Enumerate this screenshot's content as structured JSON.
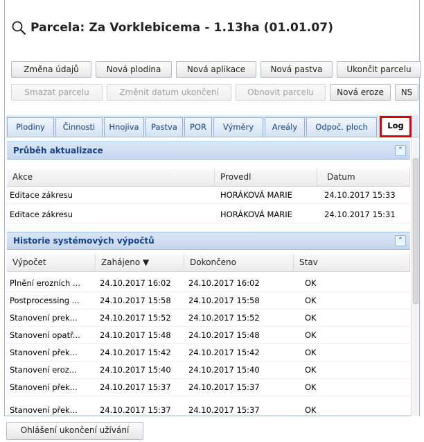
{
  "title": "Parcela: Za Vorklebicema - 1.13ha (01.01.07)",
  "toolbar_row1": [
    "Změna údajů",
    "Nová plodina",
    "Nová aplikace",
    "Nová pastva",
    "Ukončit parcelu"
  ],
  "toolbar_row2": [
    {
      "label": "Smazat parcelu",
      "disabled": true
    },
    {
      "label": "Změnit datum ukončení",
      "disabled": true
    },
    {
      "label": "Obnovit parcelu",
      "disabled": true
    },
    {
      "label": "Nová eroze",
      "disabled": false
    },
    {
      "label": "NS",
      "disabled": false
    }
  ],
  "tabs": [
    "Plodiny",
    "Činnosti",
    "Hnojiva",
    "Pastva",
    "POR",
    "Výměry",
    "Areály",
    "Odpoč. ploch",
    "Log"
  ],
  "active_tab": "Log",
  "update_section": {
    "title": "Průběh aktualizace",
    "columns": [
      "Akce",
      "Provedl",
      "Datum"
    ],
    "rows": [
      [
        "Editace zákresu",
        "HORÁKOVÁ MARIE",
        "24.10.2017 15:33"
      ],
      [
        "Editace zákresu",
        "HORÁKOVÁ MARIE",
        "24.10.2017 15:31"
      ]
    ]
  },
  "history_section": {
    "title": "Historie systémových výpočtů",
    "columns": [
      "Výpočet",
      "Zahájeno ▼",
      "Dokončeno",
      "Stav"
    ],
    "rows": [
      [
        "Plnění erozních ...",
        "24.10.2017 16:02",
        "24.10.2017 16:02",
        "OK"
      ],
      [
        "Postprocessing ...",
        "24.10.2017 15:58",
        "24.10.2017 15:58",
        "OK"
      ],
      [
        "Stanovení prek...",
        "24.10.2017 15:52",
        "24.10.2017 15:52",
        "OK"
      ],
      [
        "Stanovení opatř...",
        "24.10.2017 15:48",
        "24.10.2017 15:48",
        "OK"
      ],
      [
        "Stanovení přek...",
        "24.10.2017 15:42",
        "24.10.2017 15:42",
        "OK"
      ],
      [
        "Stanovení eroz...",
        "24.10.2017 15:40",
        "24.10.2017 15:40",
        "OK"
      ],
      [
        "Stanovení přek...",
        "24.10.2017 15:37",
        "24.10.2017 15:37",
        "OK"
      ],
      [
        "Stanovení přek...",
        "24.10.2017 15:37",
        "24.10.2017 15:37",
        "OK"
      ]
    ]
  },
  "footer_button": "Ohlášení ukončení užívání",
  "collapse_glyph": "⌃",
  "colors": {
    "header_text": "#15428b",
    "active_tab_outline": "#e00000",
    "panel_border": "#99bbe8"
  }
}
